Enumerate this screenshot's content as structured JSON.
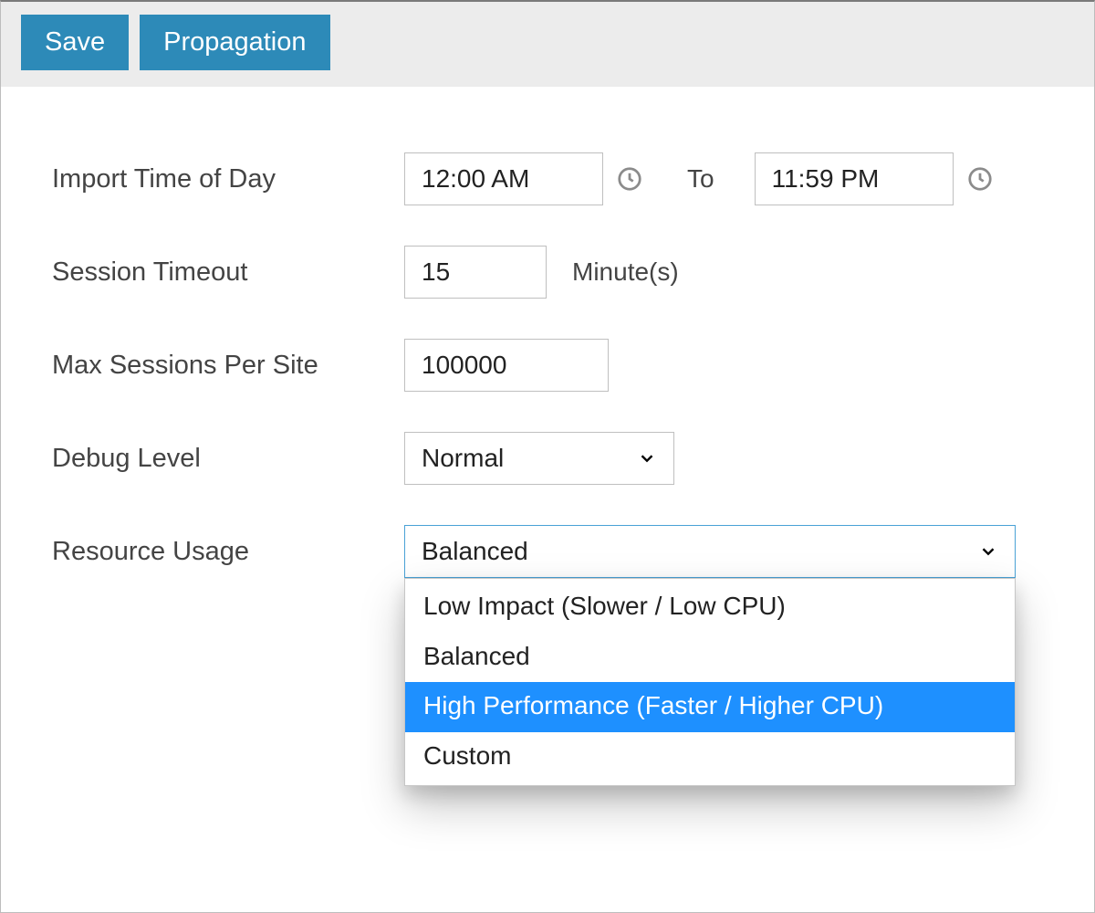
{
  "toolbar": {
    "save_label": "Save",
    "propagation_label": "Propagation"
  },
  "form": {
    "import_time": {
      "label": "Import Time of Day",
      "from_value": "12:00 AM",
      "to_label": "To",
      "to_value": "11:59 PM"
    },
    "session_timeout": {
      "label": "Session Timeout",
      "value": "15",
      "unit": "Minute(s)"
    },
    "max_sessions": {
      "label": "Max Sessions Per Site",
      "value": "100000"
    },
    "debug_level": {
      "label": "Debug Level",
      "selected": "Normal"
    },
    "resource_usage": {
      "label": "Resource Usage",
      "selected": "Balanced",
      "options": [
        "Low Impact (Slower / Low CPU)",
        "Balanced",
        "High Performance (Faster / Higher CPU)",
        "Custom"
      ],
      "highlighted_index": 2
    }
  }
}
